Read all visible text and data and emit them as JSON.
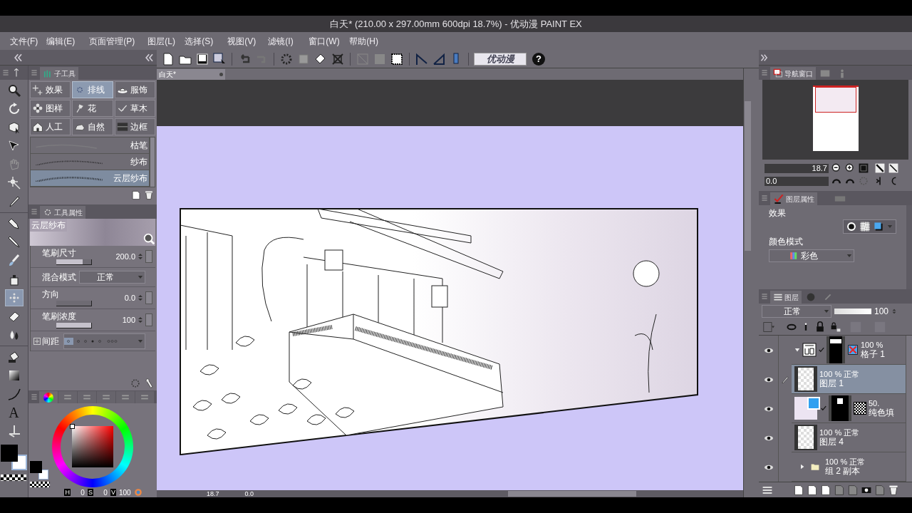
{
  "window": {
    "title": "白天* (210.00 x 297.00mm 600dpi 18.7%) - 优动漫 PAINT EX"
  },
  "menu": [
    "文件(F)",
    "编辑(E)",
    "页面管理(P)",
    "图层(L)",
    "选择(S)",
    "视图(V)",
    "滤镜(I)",
    "窗口(W)",
    "帮助(H)"
  ],
  "toolbar": {
    "logo": "优动漫",
    "help": "?"
  },
  "tool_groups": [
    {
      "tools": [
        {
          "kind": "zoom",
          "selected": false
        },
        {
          "kind": "rotate",
          "selected": false
        },
        {
          "kind": "move",
          "selected": false
        },
        {
          "kind": "operation",
          "selected": false
        },
        {
          "kind": "hand",
          "selected": false
        },
        {
          "kind": "wand",
          "selected": false
        },
        {
          "kind": "eyedropper",
          "selected": false
        }
      ]
    },
    {
      "tools": [
        {
          "kind": "pen",
          "selected": false
        },
        {
          "kind": "pencil",
          "selected": false
        },
        {
          "kind": "brush",
          "selected": false
        },
        {
          "kind": "airbrush",
          "selected": false
        },
        {
          "kind": "decoration",
          "selected": true
        },
        {
          "kind": "eraser",
          "selected": false
        },
        {
          "kind": "blend",
          "selected": false
        }
      ]
    },
    {
      "tools": [
        {
          "kind": "fill",
          "selected": false
        },
        {
          "kind": "gradient",
          "selected": false
        },
        {
          "kind": "curve",
          "selected": false
        },
        {
          "kind": "text",
          "glyph": "A",
          "selected": false
        },
        {
          "kind": "ruler",
          "selected": false
        }
      ]
    }
  ],
  "sub_tool_panel": {
    "tab": "子工具",
    "categories": [
      {
        "label": "效果",
        "kind": "sparkle",
        "selected": false
      },
      {
        "label": "排线",
        "kind": "dots",
        "selected": true
      },
      {
        "label": "服饰",
        "kind": "hat",
        "selected": false
      },
      {
        "label": "图样",
        "kind": "pattern",
        "selected": false
      },
      {
        "label": "花",
        "kind": "flower",
        "selected": false
      },
      {
        "label": "草木",
        "kind": "grass",
        "selected": false
      },
      {
        "label": "人工",
        "kind": "house",
        "selected": false
      },
      {
        "label": "自然",
        "kind": "rock",
        "selected": false
      },
      {
        "label": "边框",
        "kind": "frame",
        "selected": false
      }
    ],
    "brushes": [
      {
        "name": "枯笔",
        "selected": false
      },
      {
        "name": "纱布",
        "selected": false
      },
      {
        "name": "云层纱布",
        "selected": true
      }
    ]
  },
  "tool_property_panel": {
    "tab": "工具属性",
    "preview_name": "云层纱布",
    "properties": [
      {
        "kind": "slider",
        "label": "笔刷尺寸",
        "value": "200.0",
        "level": 0.75
      },
      {
        "kind": "dropdown",
        "label": "混合模式",
        "value": "正常"
      },
      {
        "kind": "slider",
        "label": "方向",
        "value": "0.0",
        "level": 0
      },
      {
        "kind": "slider",
        "label": "笔刷浓度",
        "value": "100",
        "level": 1
      },
      {
        "kind": "spacing",
        "label": "间距"
      }
    ]
  },
  "color_panel": {
    "hsv": [
      {
        "label": "H",
        "value": "0"
      },
      {
        "label": "S",
        "value": "0"
      },
      {
        "label": "V",
        "value": "100"
      }
    ]
  },
  "document_tab": "白天*",
  "status_bar": {
    "zoom": "18.7",
    "rotation": "0.0"
  },
  "navigator": {
    "tab": "导航窗口",
    "zoom": "18.7",
    "rotation": "0.0"
  },
  "layer_property": {
    "tab": "图层属性",
    "effect_label": "效果",
    "color_mode_label": "颜色模式",
    "color_mode": "彩色"
  },
  "layers_panel": {
    "tab": "图层",
    "blend_mode": "正常",
    "opacity": "100",
    "opacity_slider": {
      "level": 1
    },
    "layers": [
      {
        "kind": "frame",
        "visible": true,
        "selected": false,
        "expanded": true,
        "info": "100 %",
        "name": "格子 1"
      },
      {
        "kind": "raster",
        "visible": true,
        "selected": true,
        "info": "100 % 正常",
        "name": "图层 1"
      },
      {
        "kind": "fill",
        "visible": true,
        "selected": false,
        "info": "50.",
        "name": "纯色填"
      },
      {
        "kind": "raster",
        "visible": true,
        "selected": false,
        "info": "100 % 正常",
        "name": "图层 4"
      },
      {
        "kind": "folder",
        "visible": true,
        "selected": false,
        "expanded": false,
        "info": "100 % 正常",
        "name": "组 2 副本"
      }
    ]
  }
}
